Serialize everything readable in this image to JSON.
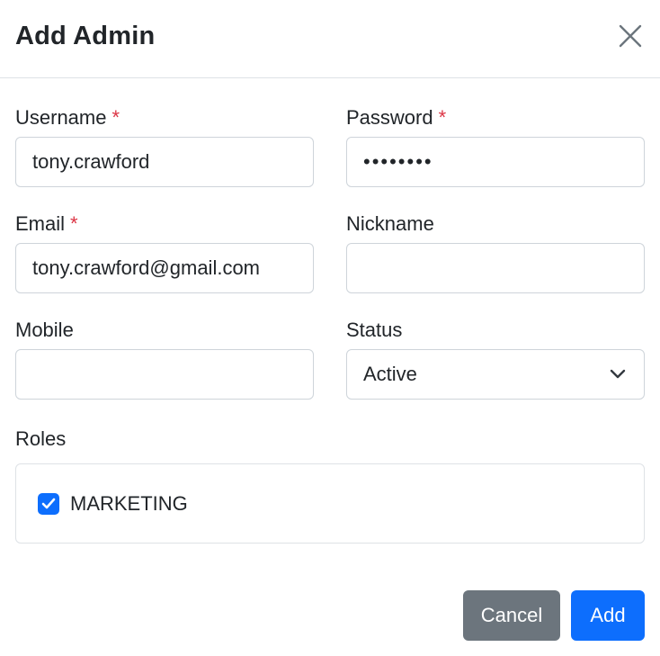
{
  "modal": {
    "title": "Add Admin"
  },
  "form": {
    "username": {
      "label": "Username",
      "required_mark": "*",
      "value": "tony.crawford"
    },
    "password": {
      "label": "Password",
      "required_mark": "*",
      "value": "password"
    },
    "email": {
      "label": "Email",
      "required_mark": "*",
      "value": "tony.crawford@gmail.com"
    },
    "nickname": {
      "label": "Nickname",
      "value": ""
    },
    "mobile": {
      "label": "Mobile",
      "value": ""
    },
    "status": {
      "label": "Status",
      "selected": "Active"
    },
    "roles": {
      "label": "Roles",
      "items": [
        {
          "label": "MARKETING",
          "checked": true
        }
      ]
    }
  },
  "footer": {
    "cancel_label": "Cancel",
    "add_label": "Add"
  },
  "colors": {
    "primary": "#0d6efd",
    "secondary": "#6c757d",
    "required": "#dc3545",
    "border": "#ced4da"
  },
  "icons": {
    "close": "close-icon",
    "chevron": "chevron-down-icon",
    "check": "check-icon"
  }
}
